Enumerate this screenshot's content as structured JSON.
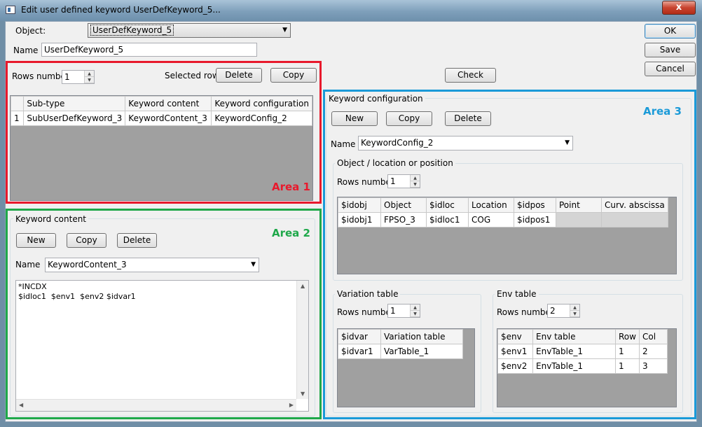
{
  "window": {
    "title": "Edit user defined keyword UserDefKeyword_5...",
    "close_glyph": "x"
  },
  "header": {
    "object_label": "Object:",
    "object_value": "UserDefKeyword_5",
    "name_label": "Name",
    "name_value": "UserDefKeyword_5"
  },
  "actions": {
    "ok": "OK",
    "save": "Save",
    "cancel": "Cancel",
    "check": "Check"
  },
  "area1": {
    "label": "Area 1",
    "color": "#e8192c",
    "rows_label": "Rows number",
    "rows_value": "1",
    "selected_row_label": "Selected row",
    "delete": "Delete",
    "copy": "Copy",
    "columns": [
      "Sub-type",
      "Keyword content",
      "Keyword configuration"
    ],
    "rows": [
      {
        "num": "1",
        "cells": [
          "SubUserDefKeyword_3",
          "KeywordContent_3",
          "KeywordConfig_2"
        ]
      }
    ]
  },
  "area2": {
    "label": "Area 2",
    "color": "#1fa84a",
    "group_title": "Keyword content",
    "new": "New",
    "copy": "Copy",
    "delete": "Delete",
    "name_label": "Name",
    "name_value": "KeywordContent_3",
    "text": "*INCDX\n$idloc1  $env1  $env2 $idvar1"
  },
  "area3": {
    "label": "Area 3",
    "color": "#1a9ad8",
    "group_title": "Keyword configuration",
    "new": "New",
    "copy": "Copy",
    "delete": "Delete",
    "name_label": "Name",
    "name_value": "KeywordConfig_2",
    "objloc": {
      "title": "Object / location or position",
      "rows_label": "Rows number",
      "rows_value": "1",
      "columns": [
        "$idobj",
        "Object",
        "$idloc",
        "Location",
        "$idpos",
        "Point",
        "Curv. abscissa"
      ],
      "rows": [
        [
          "$idobj1",
          "FPSO_3",
          "$idloc1",
          "COG",
          "$idpos1",
          "",
          ""
        ]
      ]
    },
    "variation": {
      "title": "Variation table",
      "rows_label": "Rows number",
      "rows_value": "1",
      "columns": [
        "$idvar",
        "Variation table"
      ],
      "rows": [
        [
          "$idvar1",
          "VarTable_1"
        ]
      ]
    },
    "env": {
      "title": "Env table",
      "rows_label": "Rows number",
      "rows_value": "2",
      "columns": [
        "$env",
        "Env table",
        "Row",
        "Col"
      ],
      "rows": [
        [
          "$env1",
          "EnvTable_1",
          "1",
          "2"
        ],
        [
          "$env2",
          "EnvTable_1",
          "1",
          "3"
        ]
      ]
    }
  }
}
